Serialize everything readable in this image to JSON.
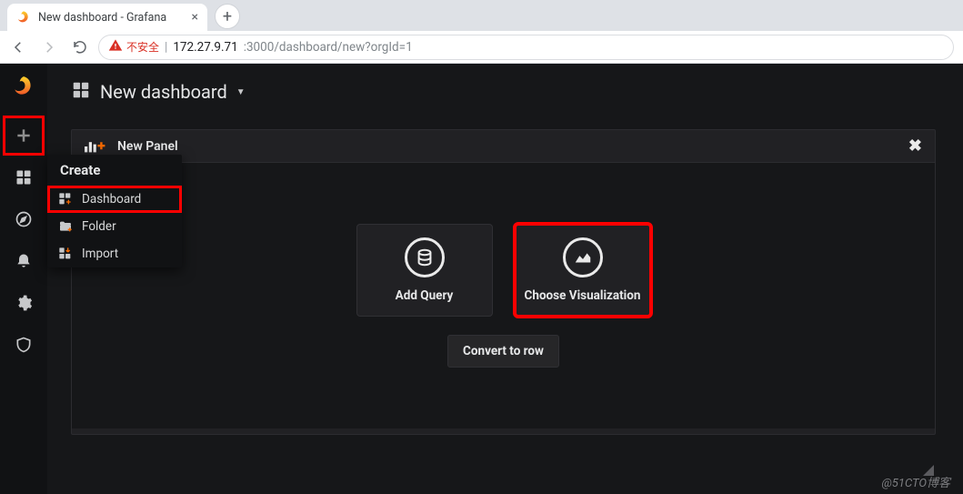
{
  "browser": {
    "tab_title": "New dashboard - Grafana",
    "insecure_label": "不安全",
    "url_host": "172.27.9.71",
    "url_port_path": ":3000/dashboard/new?orgId=1"
  },
  "header": {
    "title": "New dashboard"
  },
  "panel": {
    "title": "New Panel",
    "add_query_label": "Add Query",
    "choose_viz_label": "Choose Visualization",
    "convert_label": "Convert to row"
  },
  "create_menu": {
    "heading": "Create",
    "items": [
      {
        "label": "Dashboard",
        "icon": "dashboard"
      },
      {
        "label": "Folder",
        "icon": "folder"
      },
      {
        "label": "Import",
        "icon": "import"
      }
    ]
  },
  "watermark": "@51CTO博客"
}
